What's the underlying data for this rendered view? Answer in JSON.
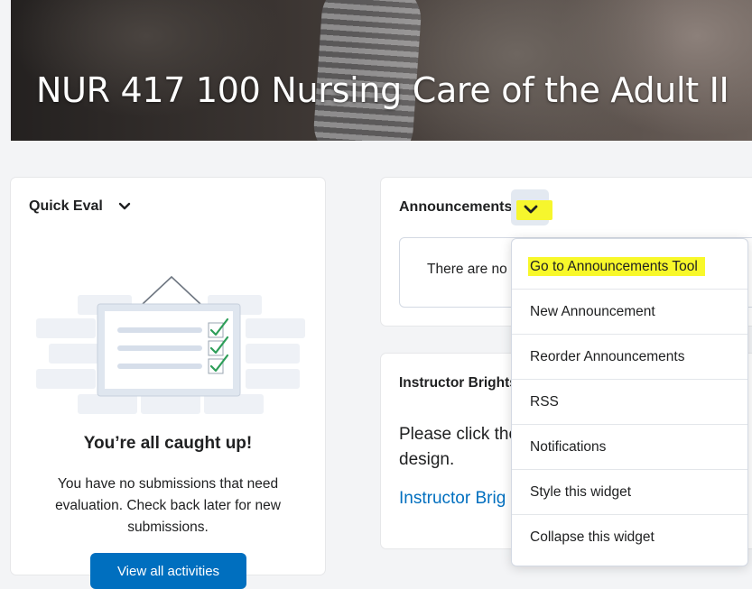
{
  "banner": {
    "title": "NUR 417 100 Nursing Care of the Adult II"
  },
  "quick_eval": {
    "title": "Quick Eval",
    "caught_up": "You’re all caught up!",
    "description": "You have no submissions that need evaluation. Check back later for new submissions.",
    "button_label": "View all activities"
  },
  "announcements": {
    "title": "Announcements",
    "empty_text": "There are no"
  },
  "instructor_widget": {
    "title": "Instructor Brights",
    "text_line1": "Please click the",
    "text_line2": "design.",
    "link": "Instructor Brig"
  },
  "dropdown_menu": {
    "items": [
      {
        "label": "Go to Announcements Tool"
      },
      {
        "label": "New Announcement"
      },
      {
        "label": "Reorder Announcements"
      },
      {
        "label": "RSS"
      },
      {
        "label": "Notifications"
      },
      {
        "label": "Style this widget"
      },
      {
        "label": "Collapse this widget"
      }
    ]
  },
  "colors": {
    "accent": "#006fbf",
    "highlight": "#f8f82a",
    "check": "#2e9e59"
  }
}
